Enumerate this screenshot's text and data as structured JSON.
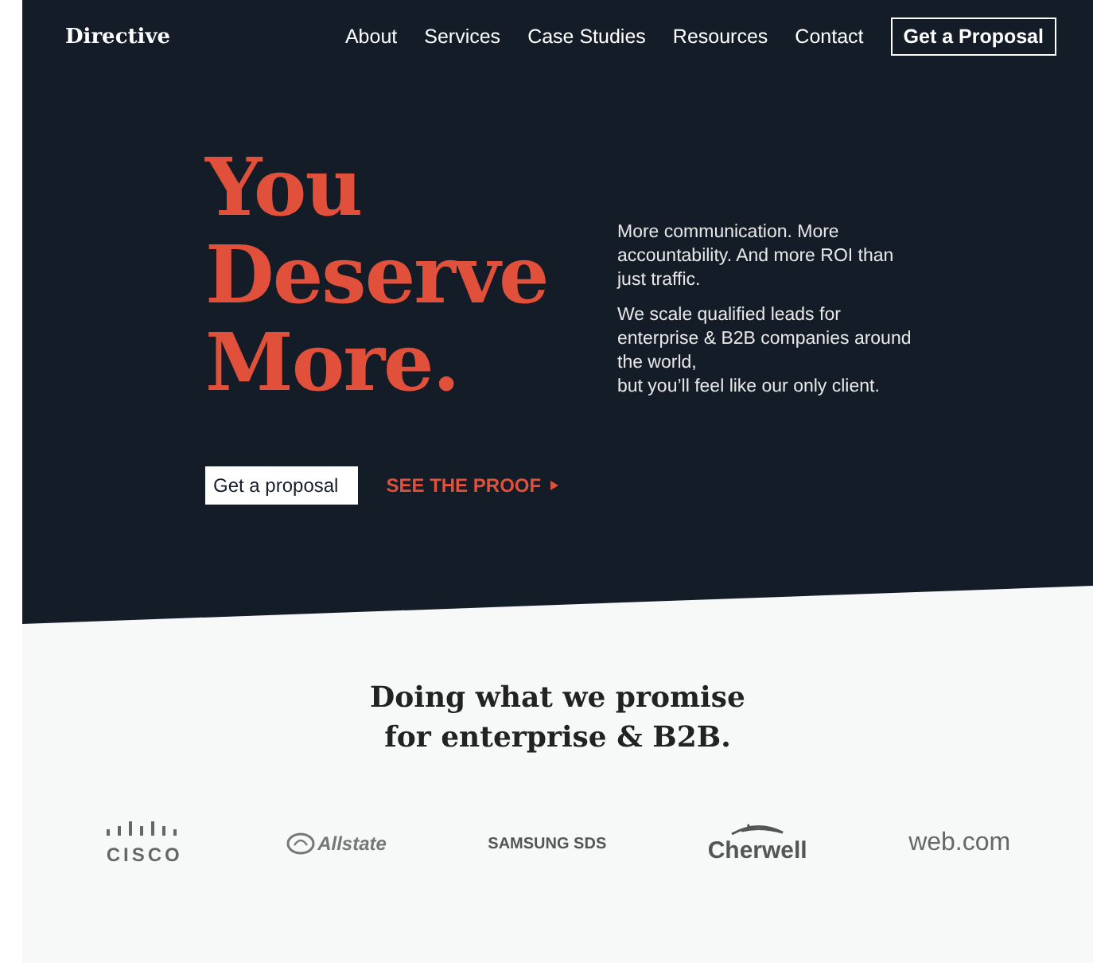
{
  "header": {
    "logo": "Directive",
    "nav": [
      {
        "label": "About"
      },
      {
        "label": "Services"
      },
      {
        "label": "Case Studies"
      },
      {
        "label": "Resources"
      },
      {
        "label": "Contact"
      }
    ],
    "cta": "Get a Proposal"
  },
  "hero": {
    "headline": [
      "You",
      "Deserve",
      "More."
    ],
    "paragraphs": [
      "More communication. More accountability. And more ROI than just traffic.",
      "We scale qualified leads for enterprise & B2B companies around the world,\nbut you’ll feel like our only client."
    ],
    "primary_button": "Get a proposal",
    "secondary_link": "SEE THE PROOF"
  },
  "clients": {
    "heading": "Doing what we promise\nfor enterprise & B2B.",
    "logos": [
      {
        "kind": "cisco",
        "name": "CISCO"
      },
      {
        "kind": "allstate",
        "name": "Allstate"
      },
      {
        "kind": "samsung",
        "name": "SAMSUNG SDS"
      },
      {
        "kind": "cherwell",
        "name": "Cherwell"
      },
      {
        "kind": "webcom",
        "name": "web.com"
      }
    ]
  }
}
